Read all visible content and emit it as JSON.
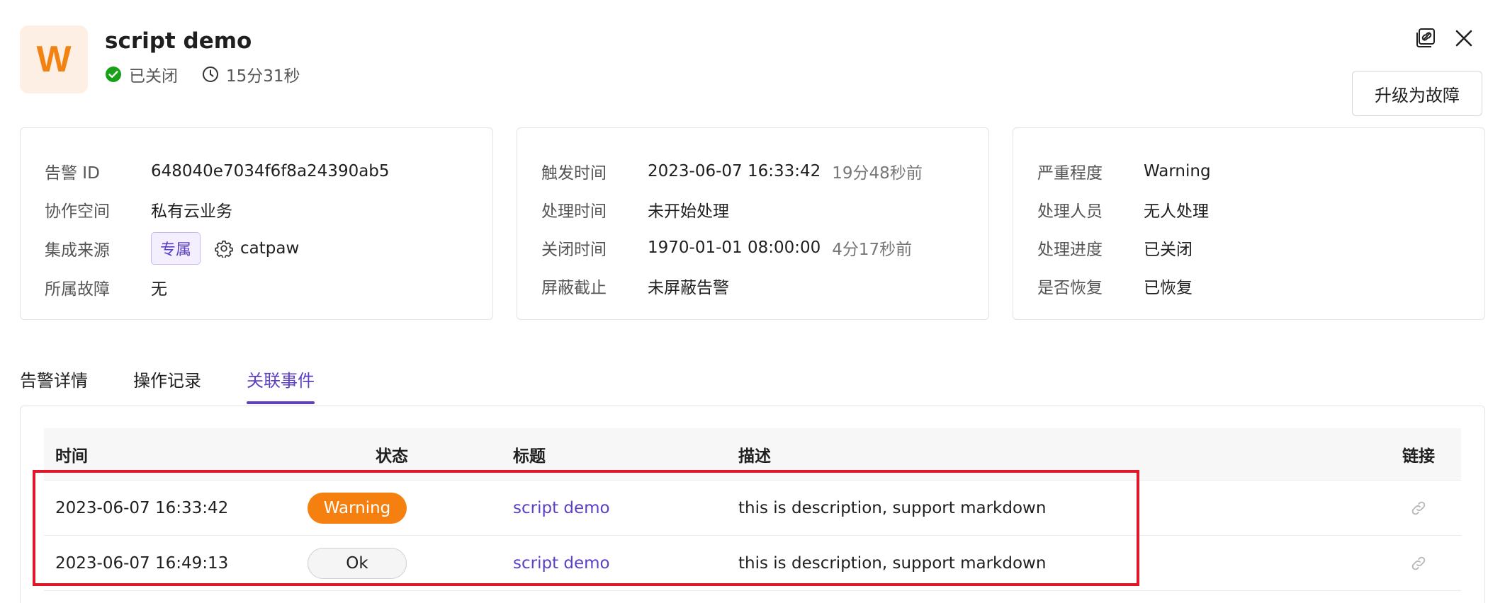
{
  "header": {
    "avatar_letter": "W",
    "title": "script demo",
    "status_text": "已关闭",
    "duration": "15分31秒",
    "upgrade_button": "升级为故障"
  },
  "cards": {
    "basic": {
      "alert_id_label": "告警 ID",
      "alert_id_value": "648040e7034f6f8a24390ab5",
      "workspace_label": "协作空间",
      "workspace_value": "私有云业务",
      "source_label": "集成来源",
      "source_tag": "专属",
      "source_value": "catpaw",
      "incident_label": "所属故障",
      "incident_value": "无"
    },
    "time": {
      "trigger_label": "触发时间",
      "trigger_value": "2023-06-07 16:33:42",
      "trigger_ago": "19分48秒前",
      "process_label": "处理时间",
      "process_value": "未开始处理",
      "close_label": "关闭时间",
      "close_value": "1970-01-01 08:00:00",
      "close_ago": "4分17秒前",
      "mute_label": "屏蔽截止",
      "mute_value": "未屏蔽告警"
    },
    "status": {
      "severity_label": "严重程度",
      "severity_value": "Warning",
      "handler_label": "处理人员",
      "handler_value": "无人处理",
      "progress_label": "处理进度",
      "progress_value": "已关闭",
      "recovered_label": "是否恢复",
      "recovered_value": "已恢复"
    }
  },
  "tabs": [
    {
      "label": "告警详情"
    },
    {
      "label": "操作记录"
    },
    {
      "label": "关联事件"
    }
  ],
  "active_tab": "关联事件",
  "table": {
    "headers": {
      "time": "时间",
      "status": "状态",
      "title": "标题",
      "description": "描述",
      "link": "链接"
    },
    "rows": [
      {
        "time": "2023-06-07 16:33:42",
        "status": "Warning",
        "title": "script demo",
        "description": "this is description, support markdown"
      },
      {
        "time": "2023-06-07 16:49:13",
        "status": "Ok",
        "title": "script demo",
        "description": "this is description, support markdown"
      }
    ]
  },
  "colors": {
    "accent": "#5c3fc4",
    "warning": "#f28313",
    "success": "#18a018",
    "highlight": "#e0162b"
  }
}
